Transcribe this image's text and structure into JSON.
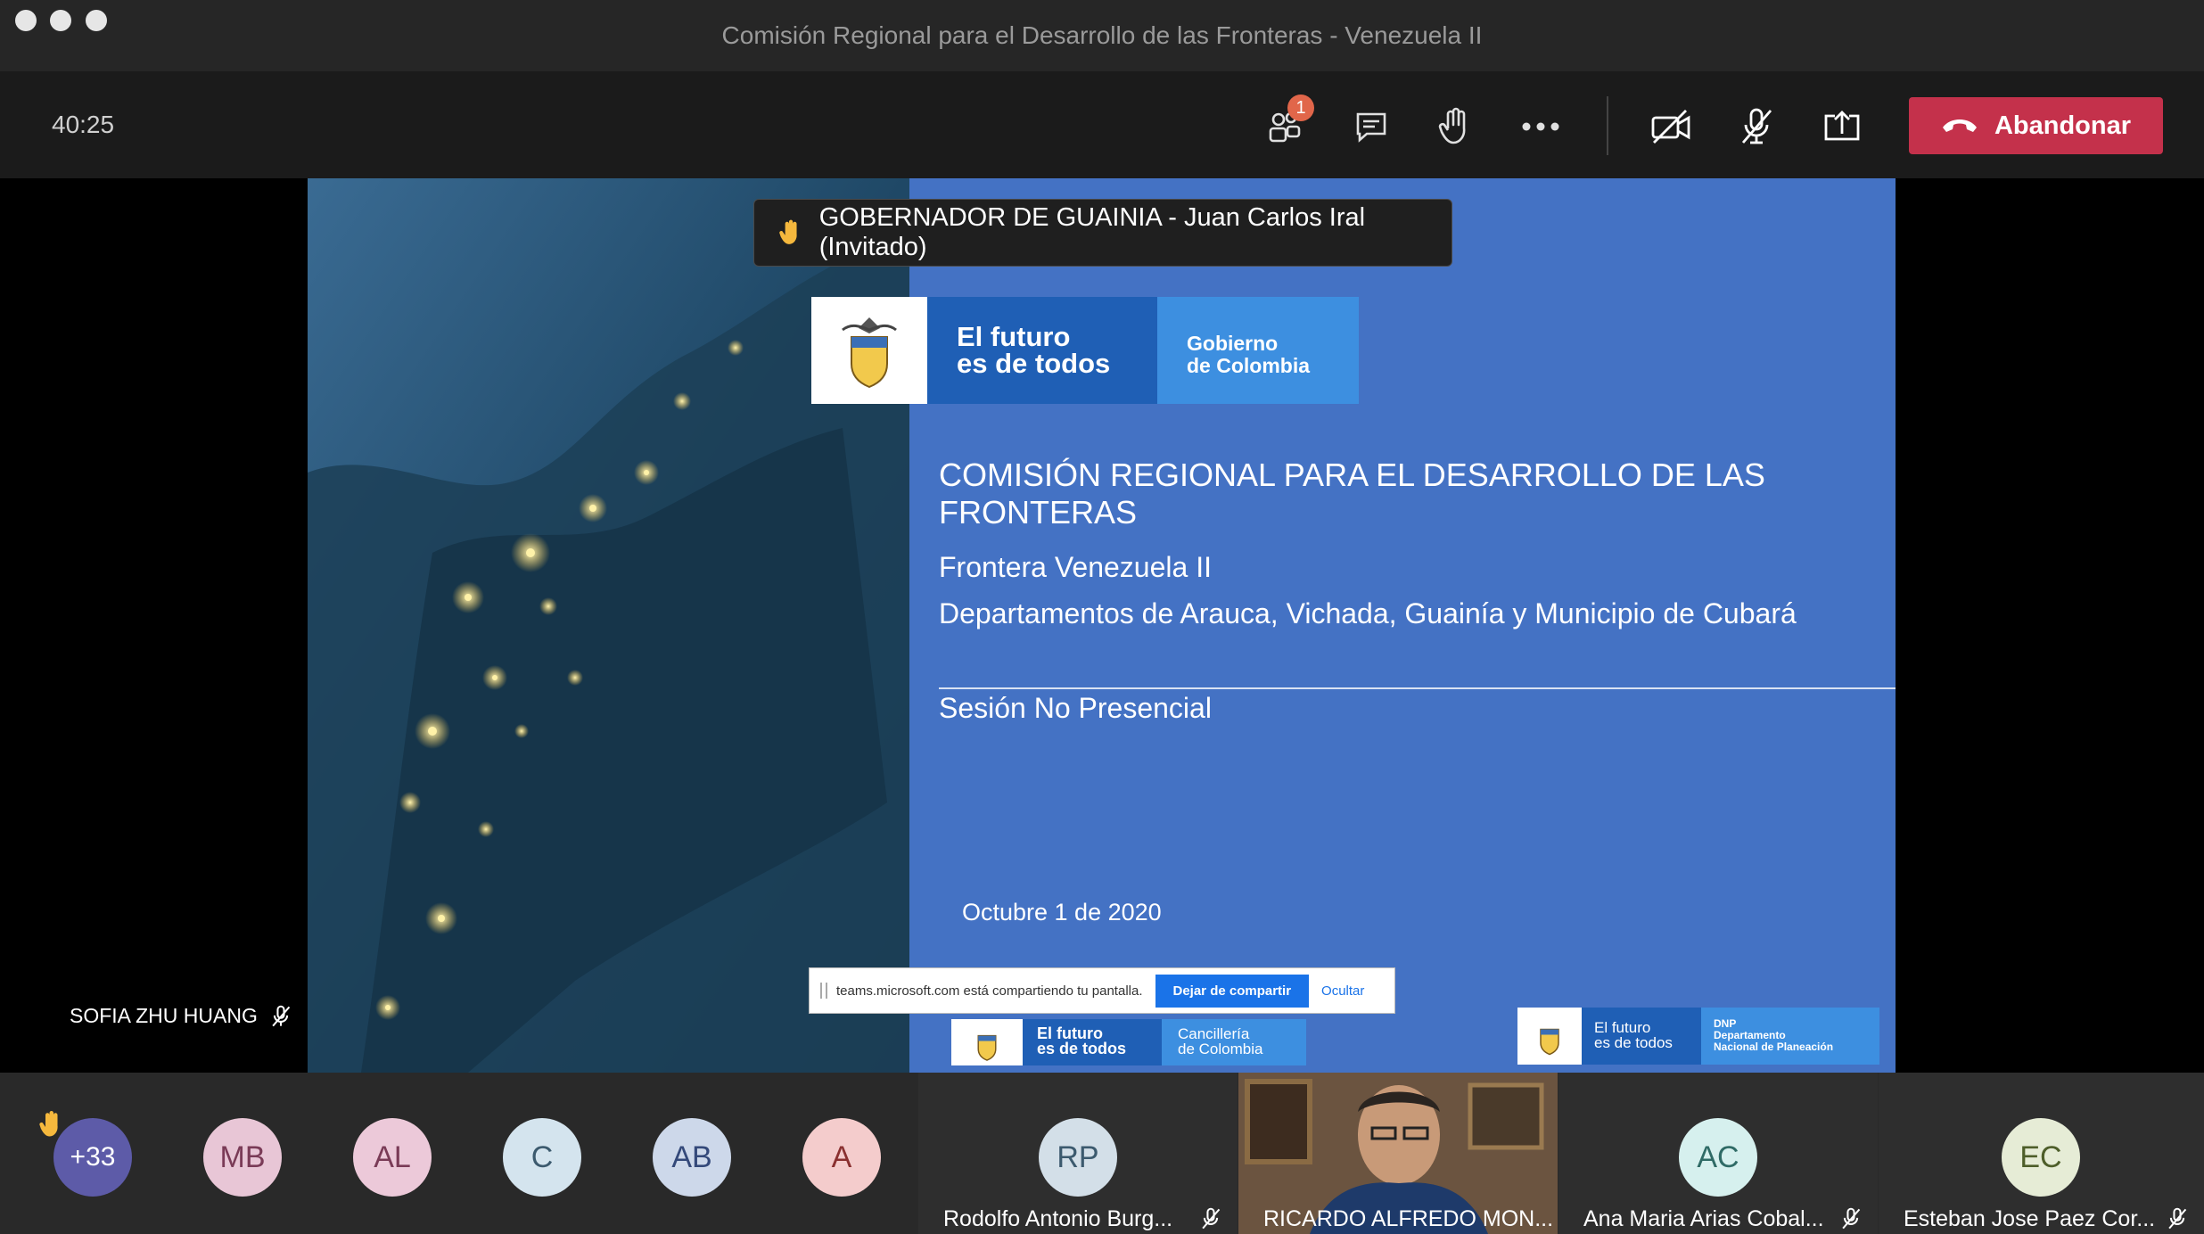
{
  "window": {
    "title": "Comisión Regional para el Desarrollo de las Fronteras - Venezuela II"
  },
  "toolbar": {
    "timer": "40:25",
    "participants_badge": "1",
    "leave_label": "Abandonar",
    "leave_color": "#c4314b"
  },
  "raised_hand_banner": {
    "text": "GOBERNADOR DE GUAINIA - Juan Carlos Iral (Invitado)"
  },
  "slide": {
    "logo_main": {
      "line1": "El futuro",
      "line2": "es de todos",
      "right1": "Gobierno",
      "right2": "de Colombia"
    },
    "title": "COMISIÓN REGIONAL PARA EL DESARROLLO DE LAS FRONTERAS",
    "subtitle": "Frontera Venezuela II",
    "departments": "Departamentos de Arauca, Vichada, Guainía y Municipio de Cubará",
    "session": "Sesión No Presencial",
    "date": "Octubre 1 de 2020",
    "footer_logo1": {
      "line1": "El futuro",
      "line2": "es de todos",
      "right1": "Cancillería",
      "right2": "de Colombia"
    },
    "footer_logo2": {
      "line1": "El futuro",
      "line2": "es de todos",
      "right1": "DNP",
      "right2": "Departamento",
      "right3": "Nacional de Planeación"
    }
  },
  "share_bar": {
    "message": "teams.microsoft.com está compartiendo tu pantalla.",
    "stop_label": "Dejar de compartir",
    "hide_label": "Ocultar"
  },
  "presenter": {
    "name": "SOFIA ZHU HUANG"
  },
  "participants": {
    "overflow": "+33",
    "avatars": [
      {
        "initials": "MB",
        "bg": "#e8c6d6",
        "fg": "#7a3b57"
      },
      {
        "initials": "AL",
        "bg": "#ecc9d9",
        "fg": "#7a3b57"
      },
      {
        "initials": "C",
        "bg": "#d4e4ee",
        "fg": "#3c5a6e"
      },
      {
        "initials": "AB",
        "bg": "#cdd8ea",
        "fg": "#34497a"
      },
      {
        "initials": "A",
        "bg": "#f4cccc",
        "fg": "#8a3030"
      }
    ],
    "tiles": [
      {
        "initials": "RP",
        "name": "Rodolfo Antonio Burg...",
        "bg": "#d3dfe8",
        "fg": "#3c5a6e"
      },
      {
        "name": "RICARDO ALFREDO MON..."
      },
      {
        "initials": "AC",
        "name": "Ana Maria Arias Cobal...",
        "bg": "#d6f0ee",
        "fg": "#2f6b66"
      },
      {
        "initials": "EC",
        "name": "Esteban Jose Paez Cor...",
        "bg": "#e6ecd6",
        "fg": "#4e5e2a"
      }
    ]
  }
}
